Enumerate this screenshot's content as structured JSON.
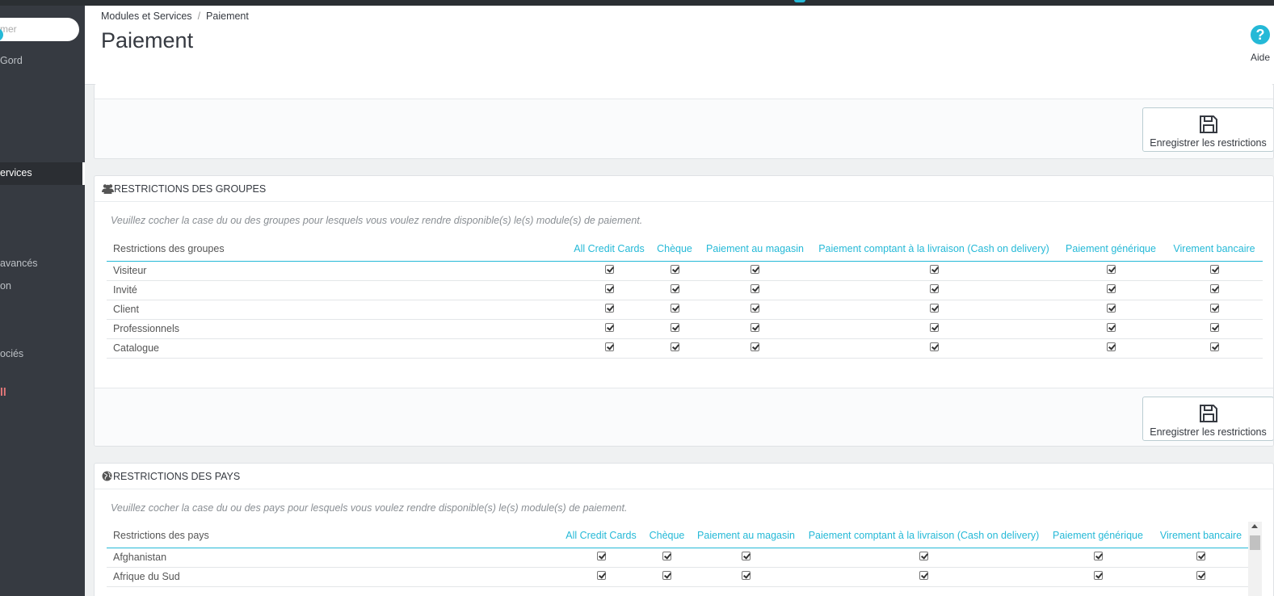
{
  "sidebar": {
    "search_placeholder": "mer",
    "items": [
      {
        "label": "Gord"
      },
      {
        "label": "ervices"
      },
      {
        "label": "avancés"
      },
      {
        "label": "on"
      },
      {
        "label": "ociés"
      }
    ]
  },
  "header": {
    "breadcrumb": [
      "Modules et Services",
      "Paiement"
    ],
    "breadcrumb_sep": "/",
    "title": "Paiement",
    "help_label": "Aide"
  },
  "save_label": "Enregistrer les restrictions",
  "groups": {
    "title": "Restrictions des groupes",
    "hint": "Veuillez cocher la case du ou des groupes pour lesquels vous voulez rendre disponible(s) le(s) module(s) de paiement.",
    "col_header": "Restrictions des groupes",
    "modules": [
      "All Credit Cards",
      "Chèque",
      "Paiement au magasin",
      "Paiement comptant à la livraison (Cash on delivery)",
      "Paiement générique",
      "Virement bancaire"
    ],
    "rows": [
      {
        "label": "Visiteur",
        "checked": [
          true,
          true,
          true,
          true,
          true,
          true
        ]
      },
      {
        "label": "Invité",
        "checked": [
          true,
          true,
          true,
          true,
          true,
          true
        ]
      },
      {
        "label": "Client",
        "checked": [
          true,
          true,
          true,
          true,
          true,
          true
        ]
      },
      {
        "label": "Professionnels",
        "checked": [
          true,
          true,
          true,
          true,
          true,
          true
        ]
      },
      {
        "label": "Catalogue",
        "checked": [
          true,
          true,
          true,
          true,
          true,
          true
        ]
      }
    ]
  },
  "countries": {
    "title": "Restrictions des pays",
    "hint": "Veuillez cocher la case du ou des pays pour lesquels vous voulez rendre disponible(s) le(s) module(s) de paiement.",
    "col_header": "Restrictions des pays",
    "modules": [
      "All Credit Cards",
      "Chèque",
      "Paiement au magasin",
      "Paiement comptant à la livraison (Cash on delivery)",
      "Paiement générique",
      "Virement bancaire"
    ],
    "rows": [
      {
        "label": "Afghanistan",
        "checked": [
          true,
          true,
          true,
          true,
          true,
          true
        ]
      },
      {
        "label": "Afrique du Sud",
        "checked": [
          true,
          true,
          true,
          true,
          true,
          true
        ]
      }
    ]
  },
  "colors": {
    "accent": "#25b9d7",
    "sidebar": "#363a41"
  }
}
